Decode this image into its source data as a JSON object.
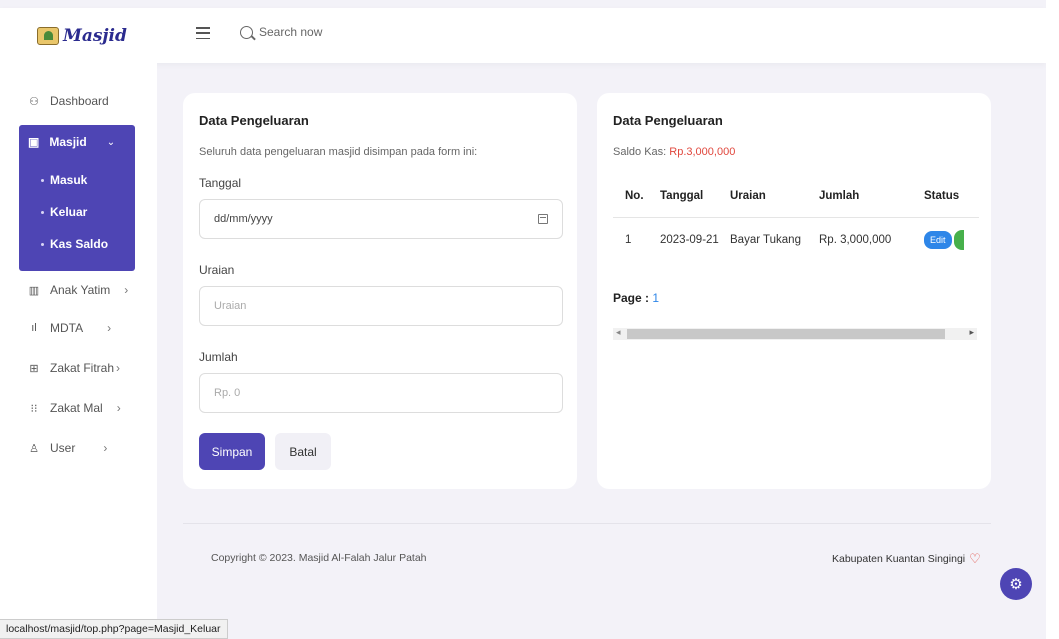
{
  "header": {
    "logo_text": "Masjid",
    "search_placeholder": "Search now"
  },
  "sidebar": {
    "dashboard": "Dashboard",
    "masjid": {
      "label": "Masjid",
      "items": [
        "Masuk",
        "Keluar",
        "Kas Saldo"
      ]
    },
    "anak_yatim": "Anak Yatim",
    "mdta": "MDTA",
    "zakat_fitrah": "Zakat Fitrah",
    "zakat_mal": "Zakat Mal",
    "user": "User"
  },
  "form": {
    "title": "Data Pengeluaran",
    "description": "Seluruh data pengeluaran masjid disimpan pada form ini:",
    "tanggal_label": "Tanggal",
    "tanggal_value": "dd/mm/yyyy",
    "uraian_label": "Uraian",
    "uraian_placeholder": "Uraian",
    "jumlah_label": "Jumlah",
    "jumlah_placeholder": "Rp. 0",
    "save_label": "Simpan",
    "cancel_label": "Batal"
  },
  "list": {
    "title": "Data Pengeluaran",
    "saldo_label": "Saldo Kas:",
    "saldo_value": "Rp.3,000,000",
    "columns": [
      "No.",
      "Tanggal",
      "Uraian",
      "Jumlah",
      "Status"
    ],
    "rows": [
      {
        "no": "1",
        "tanggal": "2023-09-21",
        "uraian": "Bayar Tukang",
        "jumlah": "Rp. 3,000,000",
        "edit_label": "Edit"
      }
    ],
    "page_label": "Page :",
    "page_number": "1"
  },
  "footer": {
    "copyright": "Copyright © 2023. Masjid Al-Falah Jalur Patah",
    "region": "Kabupaten Kuantan Singingi"
  },
  "status_bar": {
    "url": "localhost/masjid/top.php?page=Masjid_Keluar"
  },
  "colors": {
    "primary": "#4e45b4",
    "accent_red": "#e0473d",
    "link_blue": "#2e86e8",
    "background": "#f3f2f8"
  }
}
